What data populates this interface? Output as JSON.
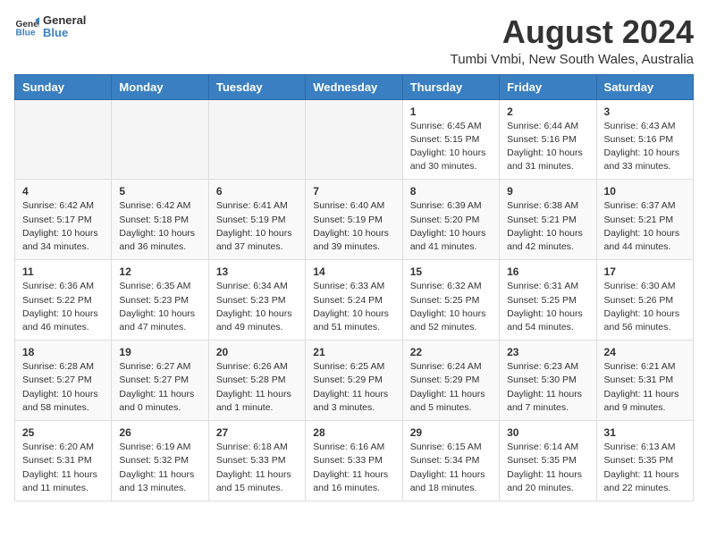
{
  "header": {
    "logo_general": "General",
    "logo_blue": "Blue",
    "main_title": "August 2024",
    "subtitle": "Tumbi Vmbi, New South Wales, Australia"
  },
  "days_of_week": [
    "Sunday",
    "Monday",
    "Tuesday",
    "Wednesday",
    "Thursday",
    "Friday",
    "Saturday"
  ],
  "weeks": [
    [
      {
        "day": "",
        "empty": true
      },
      {
        "day": "",
        "empty": true
      },
      {
        "day": "",
        "empty": true
      },
      {
        "day": "",
        "empty": true
      },
      {
        "day": "1",
        "sunrise": "6:45 AM",
        "sunset": "5:15 PM",
        "daylight": "10 hours and 30 minutes."
      },
      {
        "day": "2",
        "sunrise": "6:44 AM",
        "sunset": "5:16 PM",
        "daylight": "10 hours and 31 minutes."
      },
      {
        "day": "3",
        "sunrise": "6:43 AM",
        "sunset": "5:16 PM",
        "daylight": "10 hours and 33 minutes."
      }
    ],
    [
      {
        "day": "4",
        "sunrise": "6:42 AM",
        "sunset": "5:17 PM",
        "daylight": "10 hours and 34 minutes."
      },
      {
        "day": "5",
        "sunrise": "6:42 AM",
        "sunset": "5:18 PM",
        "daylight": "10 hours and 36 minutes."
      },
      {
        "day": "6",
        "sunrise": "6:41 AM",
        "sunset": "5:19 PM",
        "daylight": "10 hours and 37 minutes."
      },
      {
        "day": "7",
        "sunrise": "6:40 AM",
        "sunset": "5:19 PM",
        "daylight": "10 hours and 39 minutes."
      },
      {
        "day": "8",
        "sunrise": "6:39 AM",
        "sunset": "5:20 PM",
        "daylight": "10 hours and 41 minutes."
      },
      {
        "day": "9",
        "sunrise": "6:38 AM",
        "sunset": "5:21 PM",
        "daylight": "10 hours and 42 minutes."
      },
      {
        "day": "10",
        "sunrise": "6:37 AM",
        "sunset": "5:21 PM",
        "daylight": "10 hours and 44 minutes."
      }
    ],
    [
      {
        "day": "11",
        "sunrise": "6:36 AM",
        "sunset": "5:22 PM",
        "daylight": "10 hours and 46 minutes."
      },
      {
        "day": "12",
        "sunrise": "6:35 AM",
        "sunset": "5:23 PM",
        "daylight": "10 hours and 47 minutes."
      },
      {
        "day": "13",
        "sunrise": "6:34 AM",
        "sunset": "5:23 PM",
        "daylight": "10 hours and 49 minutes."
      },
      {
        "day": "14",
        "sunrise": "6:33 AM",
        "sunset": "5:24 PM",
        "daylight": "10 hours and 51 minutes."
      },
      {
        "day": "15",
        "sunrise": "6:32 AM",
        "sunset": "5:25 PM",
        "daylight": "10 hours and 52 minutes."
      },
      {
        "day": "16",
        "sunrise": "6:31 AM",
        "sunset": "5:25 PM",
        "daylight": "10 hours and 54 minutes."
      },
      {
        "day": "17",
        "sunrise": "6:30 AM",
        "sunset": "5:26 PM",
        "daylight": "10 hours and 56 minutes."
      }
    ],
    [
      {
        "day": "18",
        "sunrise": "6:28 AM",
        "sunset": "5:27 PM",
        "daylight": "10 hours and 58 minutes."
      },
      {
        "day": "19",
        "sunrise": "6:27 AM",
        "sunset": "5:27 PM",
        "daylight": "11 hours and 0 minutes."
      },
      {
        "day": "20",
        "sunrise": "6:26 AM",
        "sunset": "5:28 PM",
        "daylight": "11 hours and 1 minute."
      },
      {
        "day": "21",
        "sunrise": "6:25 AM",
        "sunset": "5:29 PM",
        "daylight": "11 hours and 3 minutes."
      },
      {
        "day": "22",
        "sunrise": "6:24 AM",
        "sunset": "5:29 PM",
        "daylight": "11 hours and 5 minutes."
      },
      {
        "day": "23",
        "sunrise": "6:23 AM",
        "sunset": "5:30 PM",
        "daylight": "11 hours and 7 minutes."
      },
      {
        "day": "24",
        "sunrise": "6:21 AM",
        "sunset": "5:31 PM",
        "daylight": "11 hours and 9 minutes."
      }
    ],
    [
      {
        "day": "25",
        "sunrise": "6:20 AM",
        "sunset": "5:31 PM",
        "daylight": "11 hours and 11 minutes."
      },
      {
        "day": "26",
        "sunrise": "6:19 AM",
        "sunset": "5:32 PM",
        "daylight": "11 hours and 13 minutes."
      },
      {
        "day": "27",
        "sunrise": "6:18 AM",
        "sunset": "5:33 PM",
        "daylight": "11 hours and 15 minutes."
      },
      {
        "day": "28",
        "sunrise": "6:16 AM",
        "sunset": "5:33 PM",
        "daylight": "11 hours and 16 minutes."
      },
      {
        "day": "29",
        "sunrise": "6:15 AM",
        "sunset": "5:34 PM",
        "daylight": "11 hours and 18 minutes."
      },
      {
        "day": "30",
        "sunrise": "6:14 AM",
        "sunset": "5:35 PM",
        "daylight": "11 hours and 20 minutes."
      },
      {
        "day": "31",
        "sunrise": "6:13 AM",
        "sunset": "5:35 PM",
        "daylight": "11 hours and 22 minutes."
      }
    ]
  ],
  "labels": {
    "sunrise": "Sunrise:",
    "sunset": "Sunset:",
    "daylight": "Daylight hours"
  }
}
